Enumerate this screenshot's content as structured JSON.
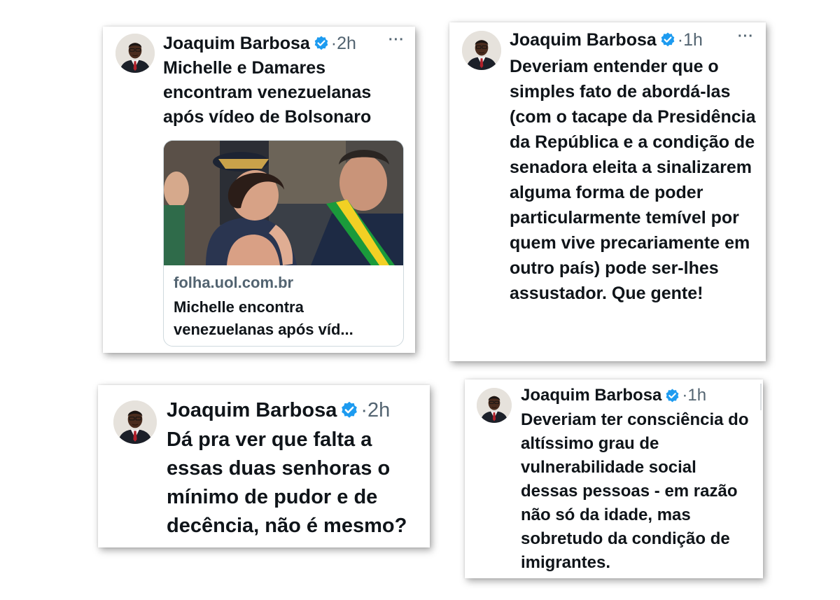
{
  "tweets": [
    {
      "author": "Joaquim Barbosa",
      "separator": "·",
      "time": "2h",
      "more": "···",
      "text": "Michelle e Damares encontram venezuelanas após vídeo de Bolsonaro",
      "link": {
        "domain": "folha.uol.com.br",
        "title": "Michelle encontra venezuelanas após víd..."
      }
    },
    {
      "author": "Joaquim Barbosa",
      "separator": "·",
      "time": "1h",
      "more": "···",
      "text": "Deveriam entender que o simples fato de abordá-las (com o tacape da Presidência da República e a condição de senadora eleita a sinalizarem alguma forma de poder particularmente temível por quem vive precariamente em outro país) pode  ser-lhes assustador. Que gente!"
    },
    {
      "author": "Joaquim Barbosa",
      "separator": "·",
      "time": "2h",
      "text": "Dá pra ver que falta  a essas duas senhoras o mínimo de pudor e de decência, não é mesmo?"
    },
    {
      "author": "Joaquim Barbosa",
      "separator": "·",
      "time": "1h",
      "text": "Deveriam ter consciência do altíssimo grau de vulnerabilidade social dessas pessoas - em razão não só da idade, mas sobretudo da condição de imigrantes."
    }
  ],
  "colors": {
    "verified_badge": "#1d9bf0",
    "secondary_text": "#536471",
    "primary_text": "#0f1419",
    "sash_green": "#1a9a3b",
    "sash_yellow": "#f2d024"
  },
  "icons": {
    "verified": "verified-badge-icon",
    "more": "more-options-icon"
  }
}
